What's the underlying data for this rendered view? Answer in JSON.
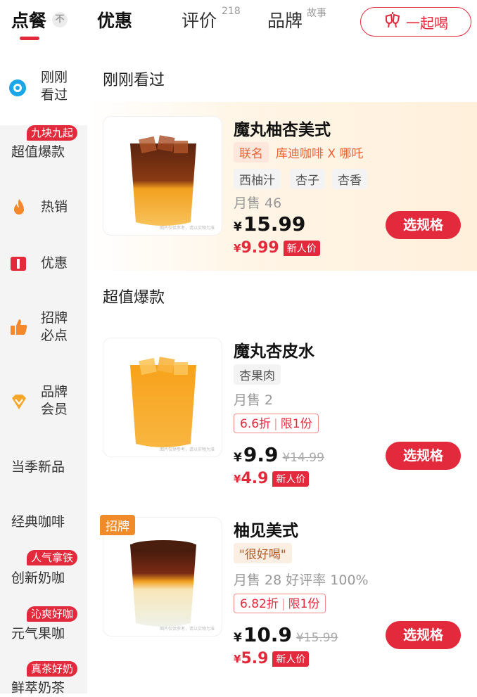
{
  "top_tabs": {
    "order": "点餐",
    "order_badge": "不",
    "deals": "优惠",
    "reviews": "评价",
    "reviews_count": "218",
    "brand": "品牌",
    "brand_sup": "故事",
    "together_button": "一起喝"
  },
  "colors": {
    "accent": "#e32a3c",
    "orange": "#f08b2a",
    "sidebar_bg": "#f4f4f4"
  },
  "sidebar": {
    "recent": {
      "line1": "刚刚",
      "line2": "看过"
    },
    "value_hits": {
      "tag": "九块九起",
      "label": "超值爆款"
    },
    "hot": {
      "label": "热销"
    },
    "deals": {
      "label": "优惠"
    },
    "signature": {
      "line1": "招牌",
      "line2": "必点"
    },
    "member": {
      "line1": "品牌",
      "line2": "会员"
    },
    "seasonal": {
      "label": "当季新品"
    },
    "classic": {
      "label": "经典咖啡"
    },
    "milk_coffee": {
      "tag": "人气拿铁",
      "label": "创新奶咖"
    },
    "fruit_coffee": {
      "tag": "沁爽好咖",
      "label": "元气果咖"
    },
    "milk_tea": {
      "tag": "真茶好奶",
      "label": "鲜萃奶茶"
    }
  },
  "sections": {
    "recent_title": "刚刚看过",
    "value_title": "超值爆款"
  },
  "products": [
    {
      "name": "魔丸柚杏美式",
      "collab_label": "联名",
      "collab_text": "库迪咖啡 X 哪吒",
      "flavors": [
        "西柚汁",
        "杏子",
        "杏香"
      ],
      "sales": "月售 46",
      "price": "15.99",
      "new_price": "9.99",
      "new_tag": "新人价",
      "button": "选规格",
      "image_caption": "图片仅供参考，请以实物为准"
    },
    {
      "name": "魔丸杏皮水",
      "flavors": [
        "杏果肉"
      ],
      "sales": "月售 2",
      "discount": "6.6折",
      "limit": "限1份",
      "price": "9.9",
      "original_price": "¥14.99",
      "new_price": "4.9",
      "new_tag": "新人价",
      "button": "选规格",
      "image_caption": "图片仅供参考，请以实物为准"
    },
    {
      "name": "柚见美式",
      "signature_tag": "招牌",
      "quote": "\"很好喝\"",
      "sales": "月售 28  好评率 100%",
      "discount": "6.82折",
      "limit": "限1份",
      "price": "10.9",
      "original_price": "¥15.99",
      "new_price": "5.9",
      "new_tag": "新人价",
      "button": "选规格",
      "image_caption": "图片仅供参考，请以实物为准"
    }
  ],
  "yen": "¥"
}
